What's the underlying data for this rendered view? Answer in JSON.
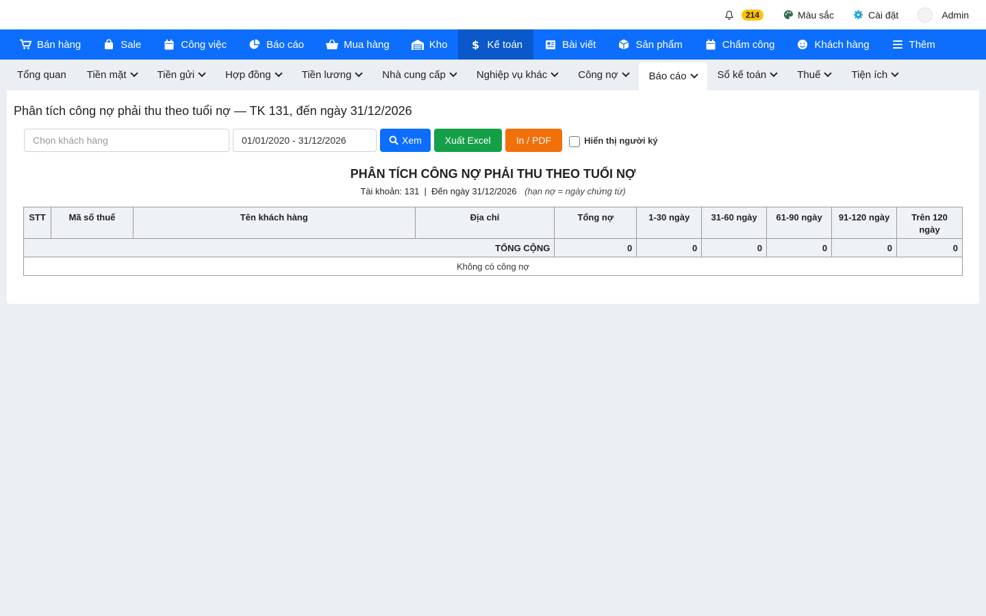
{
  "topbar": {
    "notifications_count": "214",
    "color_label": "Màu sắc",
    "settings_label": "Cài đặt",
    "user_label": "Admin"
  },
  "mainnav": [
    {
      "label": "Bán hàng",
      "icon": "cart-icon"
    },
    {
      "label": "Sale",
      "icon": "shopping-bag-icon"
    },
    {
      "label": "Công việc",
      "icon": "calendar-icon"
    },
    {
      "label": "Báo cáo",
      "icon": "pie-chart-icon"
    },
    {
      "label": "Mua hàng",
      "icon": "basket-icon"
    },
    {
      "label": "Kho",
      "icon": "warehouse-icon"
    },
    {
      "label": "Kế toán",
      "icon": "dollar-icon"
    },
    {
      "label": "Bài viết",
      "icon": "newspaper-icon"
    },
    {
      "label": "Sản phẩm",
      "icon": "box-icon"
    },
    {
      "label": "Chấm công",
      "icon": "calendar-icon"
    },
    {
      "label": "Khách hàng",
      "icon": "smile-icon"
    },
    {
      "label": "Thêm",
      "icon": "menu-icon"
    }
  ],
  "subnav": [
    "Tổng quan",
    "Tiền mặt",
    "Tiền gửi",
    "Hợp đồng",
    "Tiền lương",
    "Nhà cung cấp",
    "Nghiệp vụ khác",
    "Công nợ",
    "Báo cáo",
    "Sổ kế toán",
    "Thuế",
    "Tiện ích"
  ],
  "page_title": "Phân tích công nợ phải thu theo tuổi nợ — TK 131, đến ngày 31/12/2026",
  "filters": {
    "customer_placeholder": "Chọn khách hàng",
    "date_range": "01/01/2020 - 31/12/2026",
    "view_label": "Xem",
    "excel_label": "Xuất Excel",
    "pdf_label": "In / PDF",
    "show_signer_label": "Hiển thị người ký"
  },
  "report": {
    "title": "PHÂN TÍCH CÔNG NỢ PHẢI THU THEO TUỔI NỢ",
    "subtitle": "Tài khoản: 131  |  Đến ngày 31/12/2026",
    "note": "(hạn nợ = ngày chứng từ)"
  },
  "table": {
    "headers": [
      "STT",
      "Mã số thuế",
      "Tên khách hàng",
      "Địa chỉ",
      "Tổng nợ",
      "1-30 ngày",
      "31-60 ngày",
      "61-90 ngày",
      "91-120 ngày",
      "Trên 120 ngày"
    ],
    "total_label": "TỔNG CỘNG",
    "totals": [
      "0",
      "0",
      "0",
      "0",
      "0",
      "0"
    ],
    "empty_message": "Không có công nợ"
  },
  "colors": {
    "nav_blue": "#0d6efd",
    "nav_active": "#0a58ca",
    "excel_green": "#15a048",
    "pdf_orange": "#f26f0a",
    "badge_yellow": "#ffc107"
  }
}
